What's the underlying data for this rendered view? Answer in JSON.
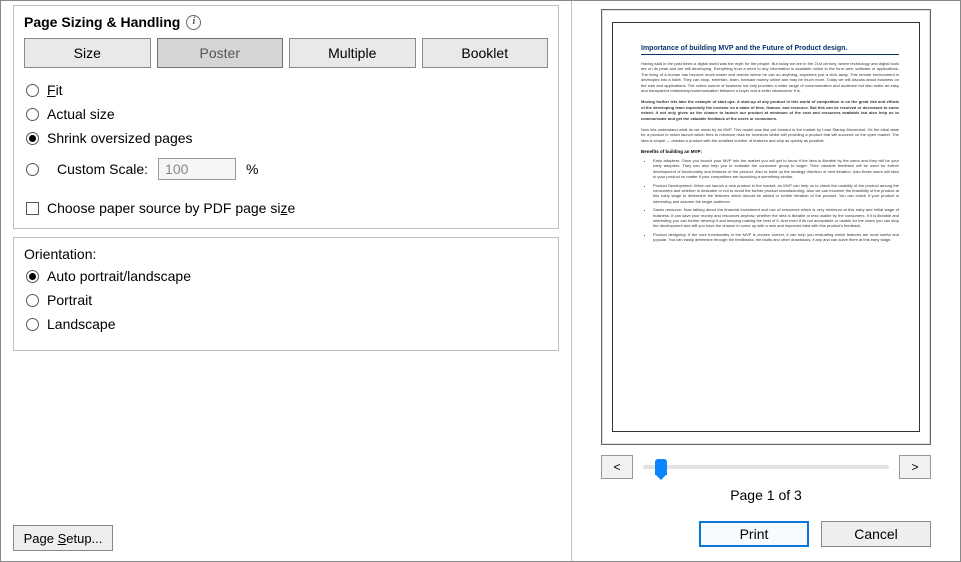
{
  "section_title": "Page Sizing & Handling",
  "segments": {
    "size": "Size",
    "poster": "Poster",
    "multiple": "Multiple",
    "booklet": "Booklet"
  },
  "radios": {
    "fit": "Fit",
    "actual": "Actual size",
    "shrink": "Shrink oversized pages",
    "custom": "Custom Scale:"
  },
  "custom_scale_value": "100",
  "scale_unit": "%",
  "paper_source_label": "Choose paper source by PDF page size",
  "orientation": {
    "label": "Orientation:",
    "auto": "Auto portrait/landscape",
    "portrait": "Portrait",
    "landscape": "Landscape"
  },
  "page_setup_btn": "Page Setup...",
  "nav_prev": "<",
  "nav_next": ">",
  "page_indicator": "Page 1 of 3",
  "print_btn": "Print",
  "cancel_btn": "Cancel",
  "doc": {
    "title": "Importance of building MVP and the Future of Product design.",
    "p1": "Having said in the past times a digital world was the myth for the people. But today we are in the 21st century, where technology and digital tools are on its peak and are still developing. Everything from a need to any information is available online in the form web, software or applications. The living of a human has become much easier and remote where he can do anything, anywhere just a click away. This remote environment is developed into a habit. They can shop, entertain, learn, transact money online and may be much more. Today we will discuss about business on the web and applications. The online source of business not only provides a wider range of communication and audience but also make an easy and transparent relationship/communication between a buyer and a seller whatsoever it is.",
    "p2": "Moving further lets take the example of start-ups. A start-up of any product in this world of competition is on the great risk and efforts of the developing team especially the investor on a stake of time, finance, and resource. But this can be resolved or decreased to some extent. It not only gives us the chance to launch our product at minimum of the cost and resources available but also help us to communicate and get the valuable feedback of the users or consumers.",
    "p3": "Now lets understand what do we mean by an MVP. This model was first put forward in the market by Lean Startup Movement. It's the ideal state for a product to reach launch which tries to minimize risks for investors whilst still providing a product that will succeed on the open market. The idea is simple — release a product with the smallest number of features and ship as quickly as possible.",
    "sub": "Benefits of building an MVP:",
    "li1": "Early adopters: Once you launch your MVP into the market you will get to know if the idea is likeable by the users and they will be your early adopters. They can also help you to evaluate the consumer group to target. Their valuable feedback will be used for further development of functionality and features of the product. Also to build up the strategy direction of next iteration. Also these users will stick to your product no matter if your competitors are launching a something similar.",
    "li2": "Product Development: When we launch a new product in the market, an MVP can help us to check the usability of the product among the consumers and whether is desirable or not to avoid the further product manufacturing. Also we can examine the feasibility of the product at this early stage to determine the features which should be added or further iteration of the product. You can check if your product is interesting and assume the target audience.",
    "li3": "Saves resource: Now talking about the financial investment and use of resources which is very minimum at this early and initial stage of business. It can save your money and resources anyhow, whether the idea is likeable or less usable by the consumers. If it is likeable and interesting you can further develop it and keeping making the best of it. And even if its not acceptable or usable for the users you can stop the development and still you have the chance to come up with a new and improved idea with this product's feedback.",
    "li4": "Product designing: If the core functionality in the MVP is chosen correct, it can help you evaluating which features are most useful and popular. You can easily determine through the feedbacks, the faults and other drawbacks, if any and can solve them at this early stage."
  }
}
